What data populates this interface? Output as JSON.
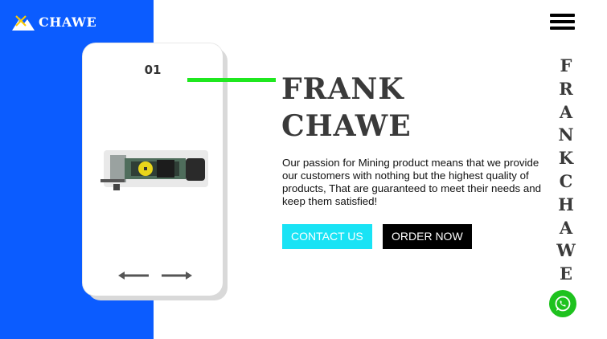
{
  "brand": {
    "name": "CHAWE"
  },
  "card": {
    "number": "01"
  },
  "hero": {
    "title_line1": "FRANK",
    "title_line2": "CHAWE",
    "description": "Our passion for Mining product means that we provide our customers with nothing but the highest quality of products, That are guaranteed to meet their needs and keep them satisfied!"
  },
  "buttons": {
    "contact": "CONTACT US",
    "order": "ORDER NOW"
  },
  "side_name": [
    "F",
    "R",
    "A",
    "N",
    "K",
    "C",
    "H",
    "A",
    "W",
    "E"
  ],
  "colors": {
    "blue_panel": "#0b5cff",
    "accent_green": "#1fe81f",
    "contact_cyan": "#19e3f5",
    "whatsapp_green": "#1ec21e"
  },
  "icons": {
    "menu": "hamburger-menu-icon",
    "whatsapp": "whatsapp-icon",
    "prev": "arrow-left-icon",
    "next": "arrow-right-icon"
  }
}
